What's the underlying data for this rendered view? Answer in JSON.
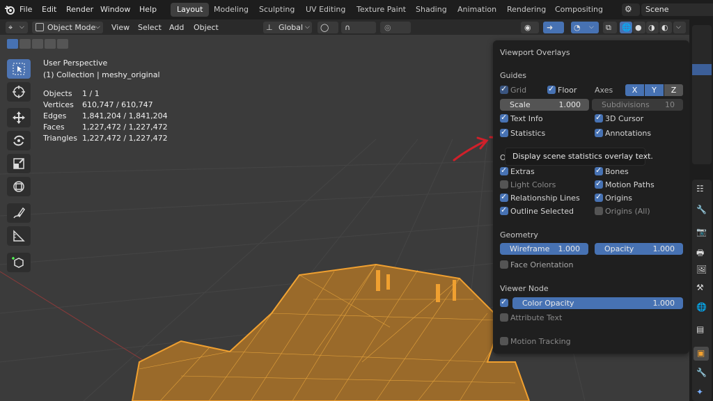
{
  "menubar": {
    "items": [
      "File",
      "Edit",
      "Render",
      "Window",
      "Help"
    ],
    "workspaces": [
      "Layout",
      "Modeling",
      "Sculpting",
      "UV Editing",
      "Texture Paint",
      "Shading",
      "Animation",
      "Rendering",
      "Compositing"
    ],
    "active_workspace": "Layout",
    "scene_label": "Scene"
  },
  "header": {
    "mode": "Object Mode",
    "menus": [
      "View",
      "Select",
      "Add",
      "Object"
    ],
    "transform_orientation": "Global"
  },
  "stats": {
    "perspective": "User Perspective",
    "collection": "(1) Collection | meshy_original",
    "rows": [
      {
        "label": "Objects",
        "value": "1 / 1"
      },
      {
        "label": "Vertices",
        "value": "610,747 / 610,747"
      },
      {
        "label": "Edges",
        "value": "1,841,204 / 1,841,204"
      },
      {
        "label": "Faces",
        "value": "1,227,472 / 1,227,472"
      },
      {
        "label": "Triangles",
        "value": "1,227,472 / 1,227,472"
      }
    ]
  },
  "overlays": {
    "title": "Viewport Overlays",
    "guides_title": "Guides",
    "grid": "Grid",
    "floor": "Floor",
    "axes": "Axes",
    "axis_x": "X",
    "axis_y": "Y",
    "axis_z": "Z",
    "scale_label": "Scale",
    "scale_value": "1.000",
    "subdivisions_label": "Subdivisions",
    "subdivisions_value": "10",
    "text_info": "Text Info",
    "cursor_3d": "3D Cursor",
    "statistics": "Statistics",
    "annotations": "Annotations",
    "objects_title_partial": "O",
    "extras": "Extras",
    "bones": "Bones",
    "light_colors": "Light Colors",
    "motion_paths": "Motion Paths",
    "relationship_lines": "Relationship Lines",
    "origins": "Origins",
    "outline_selected": "Outline Selected",
    "origins_all": "Origins (All)",
    "geometry_title": "Geometry",
    "wireframe_label": "Wireframe",
    "wireframe_value": "1.000",
    "opacity_label": "Opacity",
    "opacity_value": "1.000",
    "face_orientation": "Face Orientation",
    "viewer_node_title": "Viewer Node",
    "color_opacity_label": "Color Opacity",
    "color_opacity_value": "1.000",
    "attribute_text": "Attribute Text",
    "motion_tracking": "Motion Tracking"
  },
  "tooltip": {
    "text": "Display scene statistics overlay text."
  },
  "colors": {
    "accent": "#4772b3",
    "mesh_wire": "#f0a030",
    "annotation": "#d0202a"
  }
}
